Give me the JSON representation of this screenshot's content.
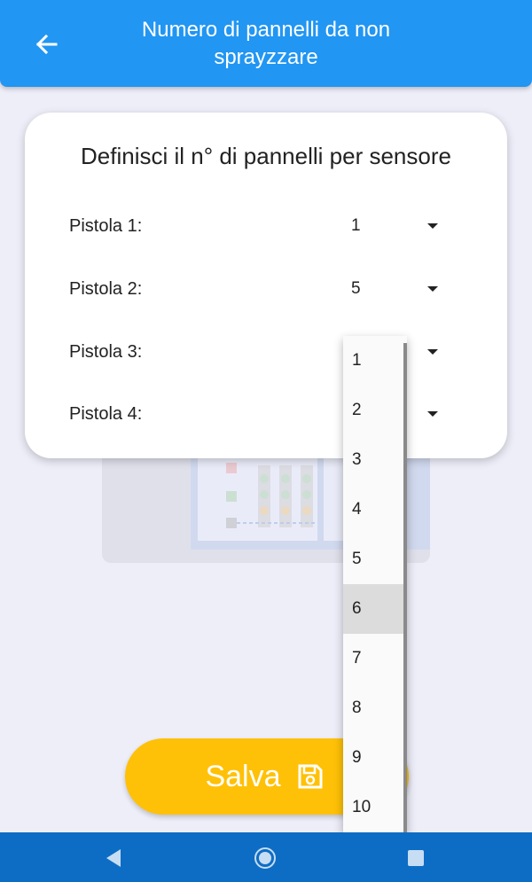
{
  "appbar": {
    "title": "Numero di pannelli da non sprayzzare",
    "back_icon": "arrow-left-icon"
  },
  "card": {
    "title": "Definisci il n° di pannelli per sensore",
    "rows": [
      {
        "label": "Pistola 1:",
        "value": "1"
      },
      {
        "label": "Pistola 2:",
        "value": "5"
      },
      {
        "label": "Pistola 3:",
        "value": ""
      },
      {
        "label": "Pistola 4:",
        "value": ""
      }
    ]
  },
  "dropdown": {
    "options": [
      "1",
      "2",
      "3",
      "4",
      "5",
      "6",
      "7",
      "8",
      "9",
      "10"
    ],
    "highlighted": "6"
  },
  "save_button": {
    "label": "Salva",
    "icon": "save-icon"
  },
  "navbar": {
    "icons": [
      "nav-back-icon",
      "nav-home-icon",
      "nav-recents-icon"
    ]
  },
  "colors": {
    "appbar": "#2196f3",
    "background": "#eeeef9",
    "save_button": "#ffc107",
    "navbar": "#0d6dc4"
  }
}
